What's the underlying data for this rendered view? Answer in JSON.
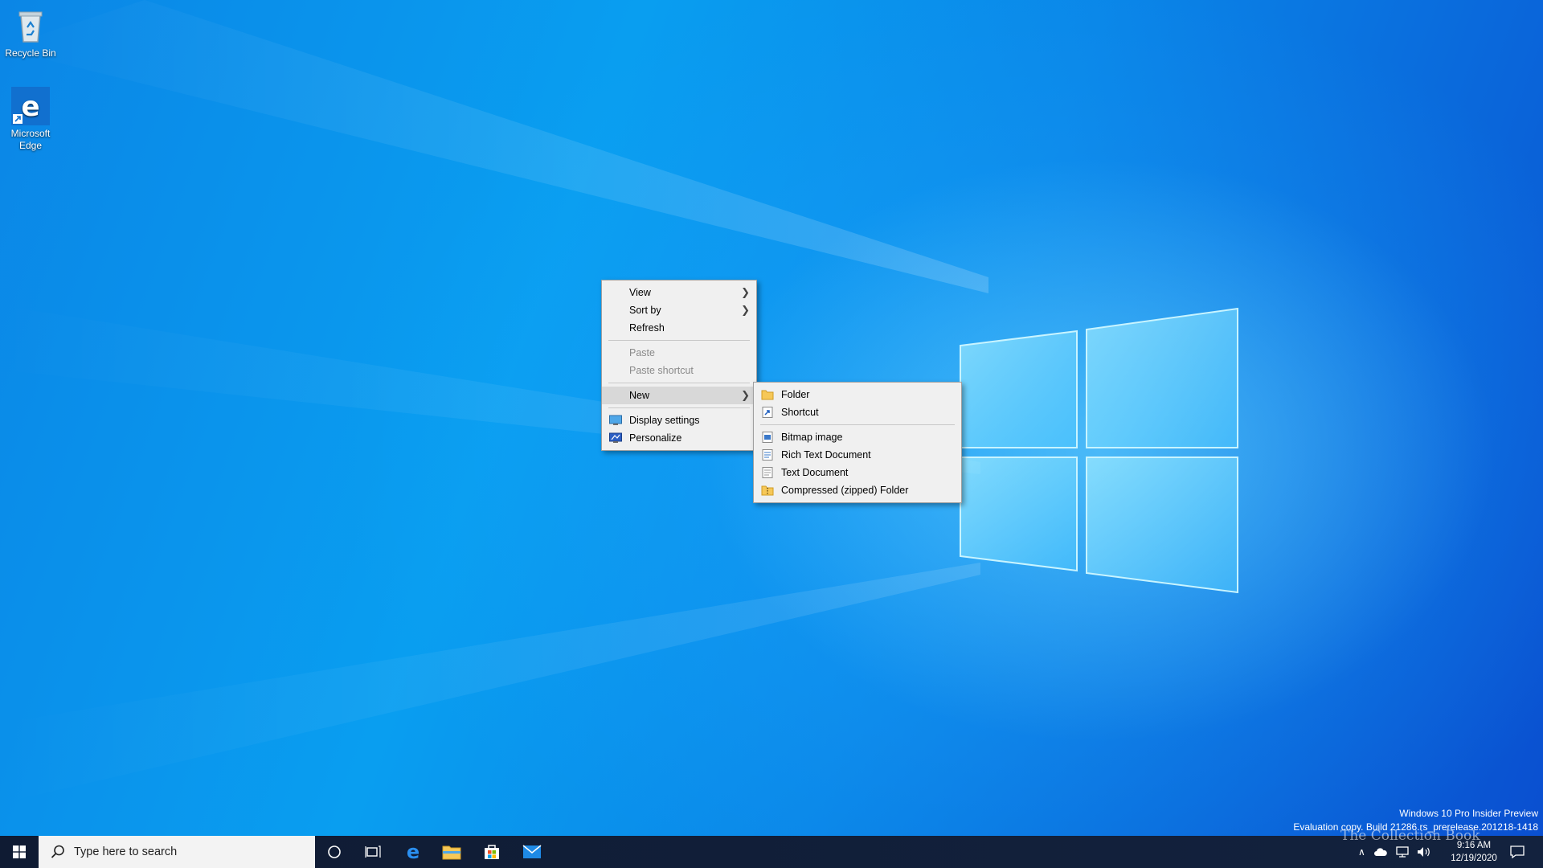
{
  "desktop": {
    "icons": [
      {
        "label": "Recycle Bin"
      },
      {
        "label": "Microsoft Edge"
      }
    ]
  },
  "context_menu": {
    "items": [
      {
        "label": "View",
        "has_submenu": true,
        "enabled": true
      },
      {
        "label": "Sort by",
        "has_submenu": true,
        "enabled": true
      },
      {
        "label": "Refresh",
        "has_submenu": false,
        "enabled": true
      },
      {
        "label": "Paste",
        "enabled": false
      },
      {
        "label": "Paste shortcut",
        "enabled": false
      },
      {
        "label": "New",
        "has_submenu": true,
        "enabled": true,
        "active": true
      },
      {
        "label": "Display settings",
        "icon": "display-icon",
        "enabled": true
      },
      {
        "label": "Personalize",
        "icon": "personalize-icon",
        "enabled": true
      }
    ]
  },
  "new_submenu": {
    "items": [
      {
        "label": "Folder",
        "icon": "folder-icon"
      },
      {
        "label": "Shortcut",
        "icon": "shortcut-icon"
      },
      {
        "label": "Bitmap image",
        "icon": "bitmap-icon"
      },
      {
        "label": "Rich Text Document",
        "icon": "rich-text-icon"
      },
      {
        "label": "Text Document",
        "icon": "text-document-icon"
      },
      {
        "label": "Compressed (zipped) Folder",
        "icon": "zip-folder-icon"
      }
    ]
  },
  "watermark": {
    "line1": "Windows 10 Pro Insider Preview",
    "line2": "Evaluation copy. Build 21286.rs_prerelease.201218-1418"
  },
  "taskbar": {
    "search_placeholder": "Type here to search",
    "pinned": [
      "cortana-icon",
      "task-view-icon",
      "edge-icon",
      "file-explorer-icon",
      "store-icon",
      "mail-icon"
    ],
    "tray_logo_text": "The Collection Book",
    "clock_time": "9:16 AM",
    "clock_date": "12/19/2020"
  },
  "colors": {
    "accent": "#0078d7",
    "taskbar": "#101a2e",
    "menu_bg": "#f0f0f0"
  }
}
